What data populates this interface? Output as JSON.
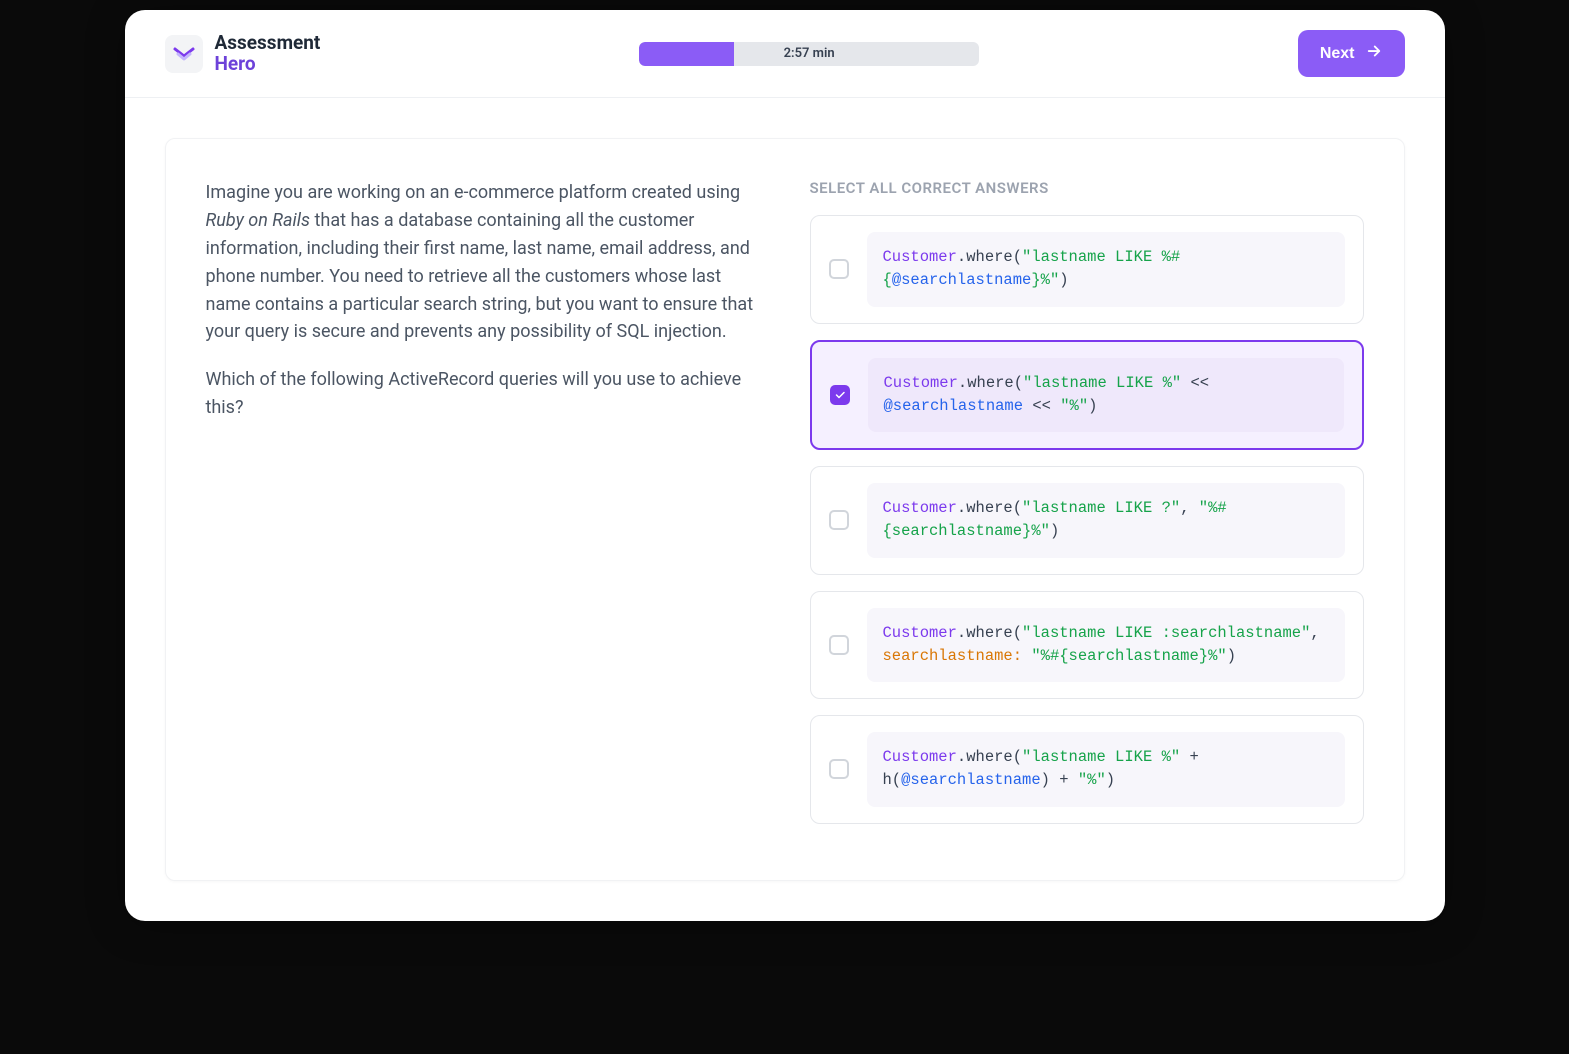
{
  "brand": {
    "line1": "Assessment",
    "line2": "Hero"
  },
  "progress": {
    "percent": 28,
    "label": "2:57 min"
  },
  "next_label": "Next",
  "question": {
    "p1_before_em": "Imagine you are working on an e-commerce platform created using ",
    "p1_em": "Ruby on Rails",
    "p1_after_em": " that has a database containing all the customer information, including their first name, last name, email address, and phone number. You need to retrieve all the customers whose last name contains a particular search string, but you want to ensure that your query is secure and prevents any possibility of SQL injection.",
    "p2": "Which of the following ActiveRecord queries will you use to achieve this?"
  },
  "answers_heading": "SELECT ALL CORRECT ANSWERS",
  "answers": [
    {
      "checked": false,
      "tokens": [
        {
          "t": "class",
          "v": "Customer"
        },
        {
          "t": "plain",
          "v": ".where("
        },
        {
          "t": "str",
          "v": "\"lastname LIKE %#{"
        },
        {
          "t": "ivar",
          "v": "@searchlastname"
        },
        {
          "t": "str",
          "v": "}%\""
        },
        {
          "t": "plain",
          "v": ")"
        }
      ]
    },
    {
      "checked": true,
      "tokens": [
        {
          "t": "class",
          "v": "Customer"
        },
        {
          "t": "plain",
          "v": ".where("
        },
        {
          "t": "str",
          "v": "\"lastname LIKE %\""
        },
        {
          "t": "plain",
          "v": " << "
        },
        {
          "t": "ivar",
          "v": "@searchlastname"
        },
        {
          "t": "plain",
          "v": " << "
        },
        {
          "t": "str",
          "v": "\"%\""
        },
        {
          "t": "plain",
          "v": ")"
        }
      ]
    },
    {
      "checked": false,
      "tokens": [
        {
          "t": "class",
          "v": "Customer"
        },
        {
          "t": "plain",
          "v": ".where("
        },
        {
          "t": "str",
          "v": "\"lastname LIKE ?\""
        },
        {
          "t": "plain",
          "v": ", "
        },
        {
          "t": "str",
          "v": "\"%#{searchlastname}%\""
        },
        {
          "t": "plain",
          "v": ")"
        }
      ]
    },
    {
      "checked": false,
      "tokens": [
        {
          "t": "class",
          "v": "Customer"
        },
        {
          "t": "plain",
          "v": ".where("
        },
        {
          "t": "str",
          "v": "\"lastname LIKE :searchlastname\""
        },
        {
          "t": "plain",
          "v": ", "
        },
        {
          "t": "key",
          "v": "searchlastname:"
        },
        {
          "t": "plain",
          "v": " "
        },
        {
          "t": "str",
          "v": "\"%#{searchlastname}%\""
        },
        {
          "t": "plain",
          "v": ")"
        }
      ]
    },
    {
      "checked": false,
      "tokens": [
        {
          "t": "class",
          "v": "Customer"
        },
        {
          "t": "plain",
          "v": ".where("
        },
        {
          "t": "str",
          "v": "\"lastname LIKE %\""
        },
        {
          "t": "plain",
          "v": " + h("
        },
        {
          "t": "ivar",
          "v": "@searchlastname"
        },
        {
          "t": "plain",
          "v": ") + "
        },
        {
          "t": "str",
          "v": "\"%\""
        },
        {
          "t": "plain",
          "v": ")"
        }
      ]
    }
  ]
}
